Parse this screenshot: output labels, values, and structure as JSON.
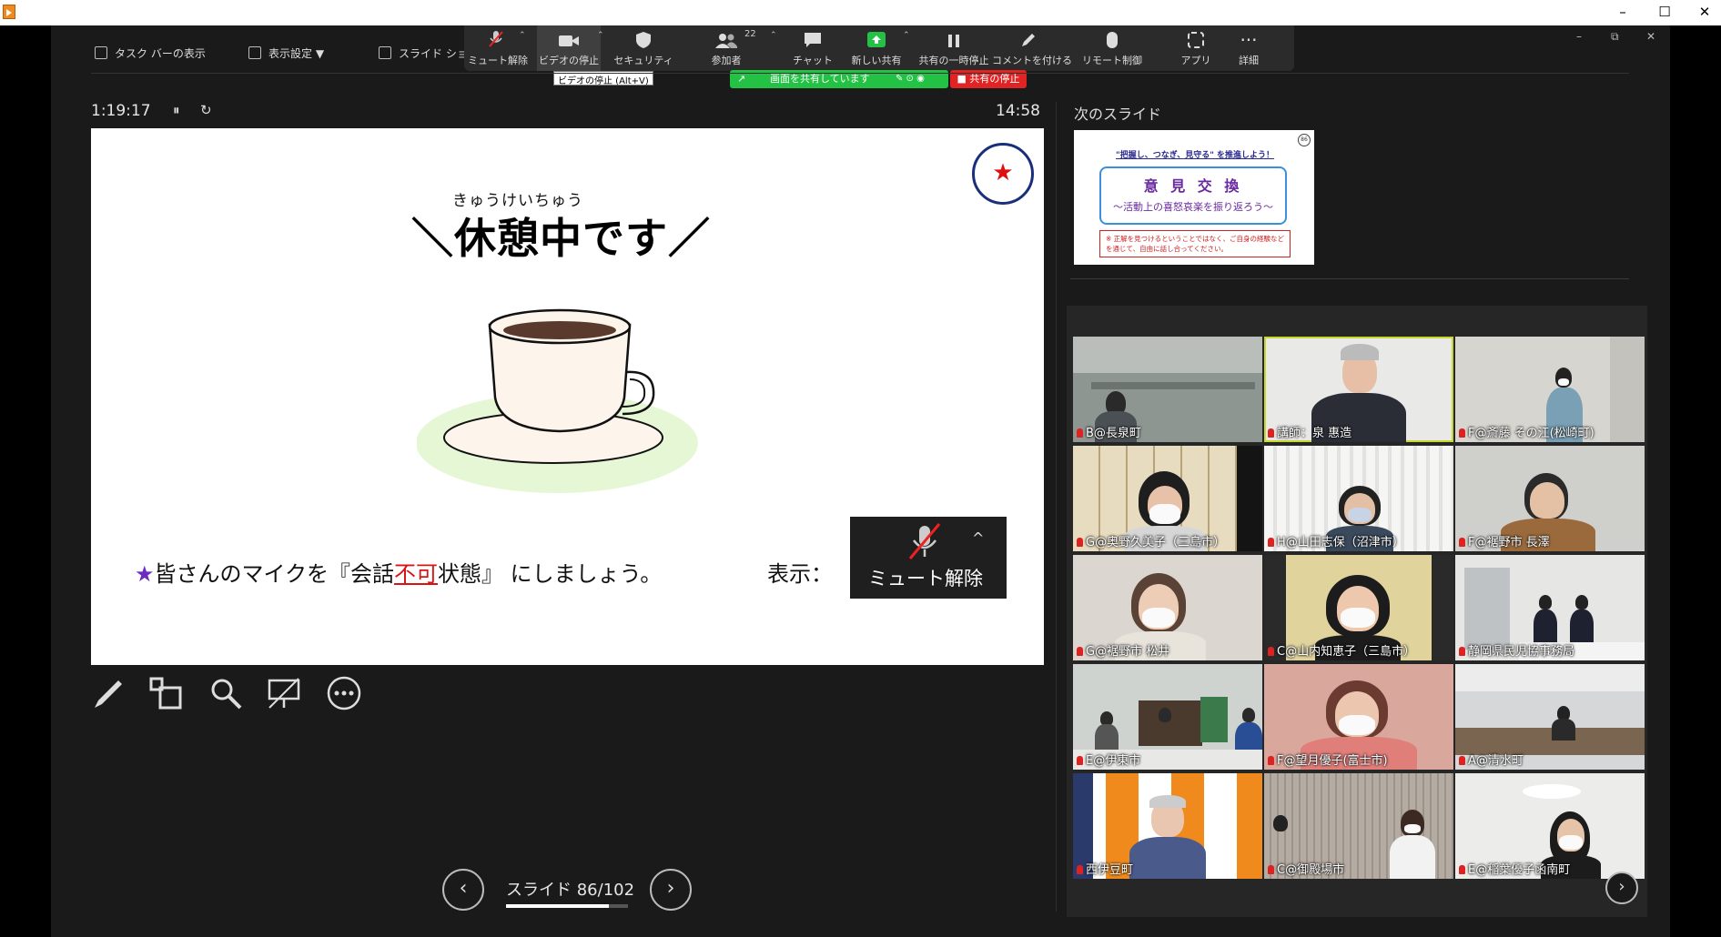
{
  "window": {
    "min": "–",
    "max": "☐",
    "close": "✕"
  },
  "presenter_toolbar": {
    "taskbar": "タスク バーの表示",
    "display_settings": "表示設定 ▼",
    "slideshow": "スライド ショ"
  },
  "zoom_toolbar": {
    "mute": "ミュート解除",
    "video": "ビデオの停止",
    "security": "セキュリティ",
    "participants": "参加者",
    "participant_count": "22",
    "chat": "チャット",
    "new_share": "新しい共有",
    "pause_share": "共有の一時停止",
    "annotate": "コメントを付ける",
    "remote_control": "リモート制御",
    "apps": "アプリ",
    "more": "詳細",
    "tooltip": "ビデオの停止 (Alt+V)",
    "sharing_status": "画面を共有しています",
    "stop_share": "■ 共有の停止"
  },
  "timer": {
    "elapsed": "1:19:17",
    "pause_icon": "⏸",
    "reset_icon": "↻",
    "clock": "14:58"
  },
  "slide": {
    "ruby": "きゅうけいちゅう",
    "title": "＼休憩中です／",
    "star": "★",
    "note_star": "★",
    "note_pre": "皆さんのマイクを『会話",
    "note_red": "不可",
    "note_post": "状態』 にしましょう。",
    "display_label": "表示：",
    "mute_label": "ミュート解除",
    "mute_caret": "^"
  },
  "next_slide": {
    "label": "次のスライド",
    "top_line": "\"把握し、つなぎ、見守る\" を推進しよう！",
    "box_title": "意 見 交 換",
    "box_sub": "～活動上の喜怒哀楽を振り返ろう～",
    "note": "※ 正解を見つけるということではなく、ご自身の経験などを通じて、自由に話し合ってください。",
    "badge": "86"
  },
  "gallery": {
    "tiles": [
      {
        "name": "B@長泉町"
      },
      {
        "name": "講師：泉 惠造"
      },
      {
        "name": "F@斎藤 その江(松崎町)"
      },
      {
        "name": "G@奥野久美子（三島市）"
      },
      {
        "name": "H@山田志保（沼津市）"
      },
      {
        "name": "F@裾野市 長澤"
      },
      {
        "name": "G@裾野市 松井"
      },
      {
        "name": "C@山内知恵子（三島市）"
      },
      {
        "name": "静岡県民児協事務局"
      },
      {
        "name": "E@伊東市"
      },
      {
        "name": "F@望月優子(富士市)"
      },
      {
        "name": "A@清水町"
      },
      {
        "name": "西伊豆町"
      },
      {
        "name": "C@御殿場市"
      },
      {
        "name": "E@稲葉優子函南町"
      }
    ],
    "next": "›"
  },
  "slide_nav": {
    "prev": "‹",
    "next": "›",
    "counter": "スライド 86/102",
    "progress_fraction": 0.843
  },
  "colors": {
    "share_green": "#23c144",
    "stop_red": "#e02424",
    "speaker_highlight": "#c8d830"
  }
}
